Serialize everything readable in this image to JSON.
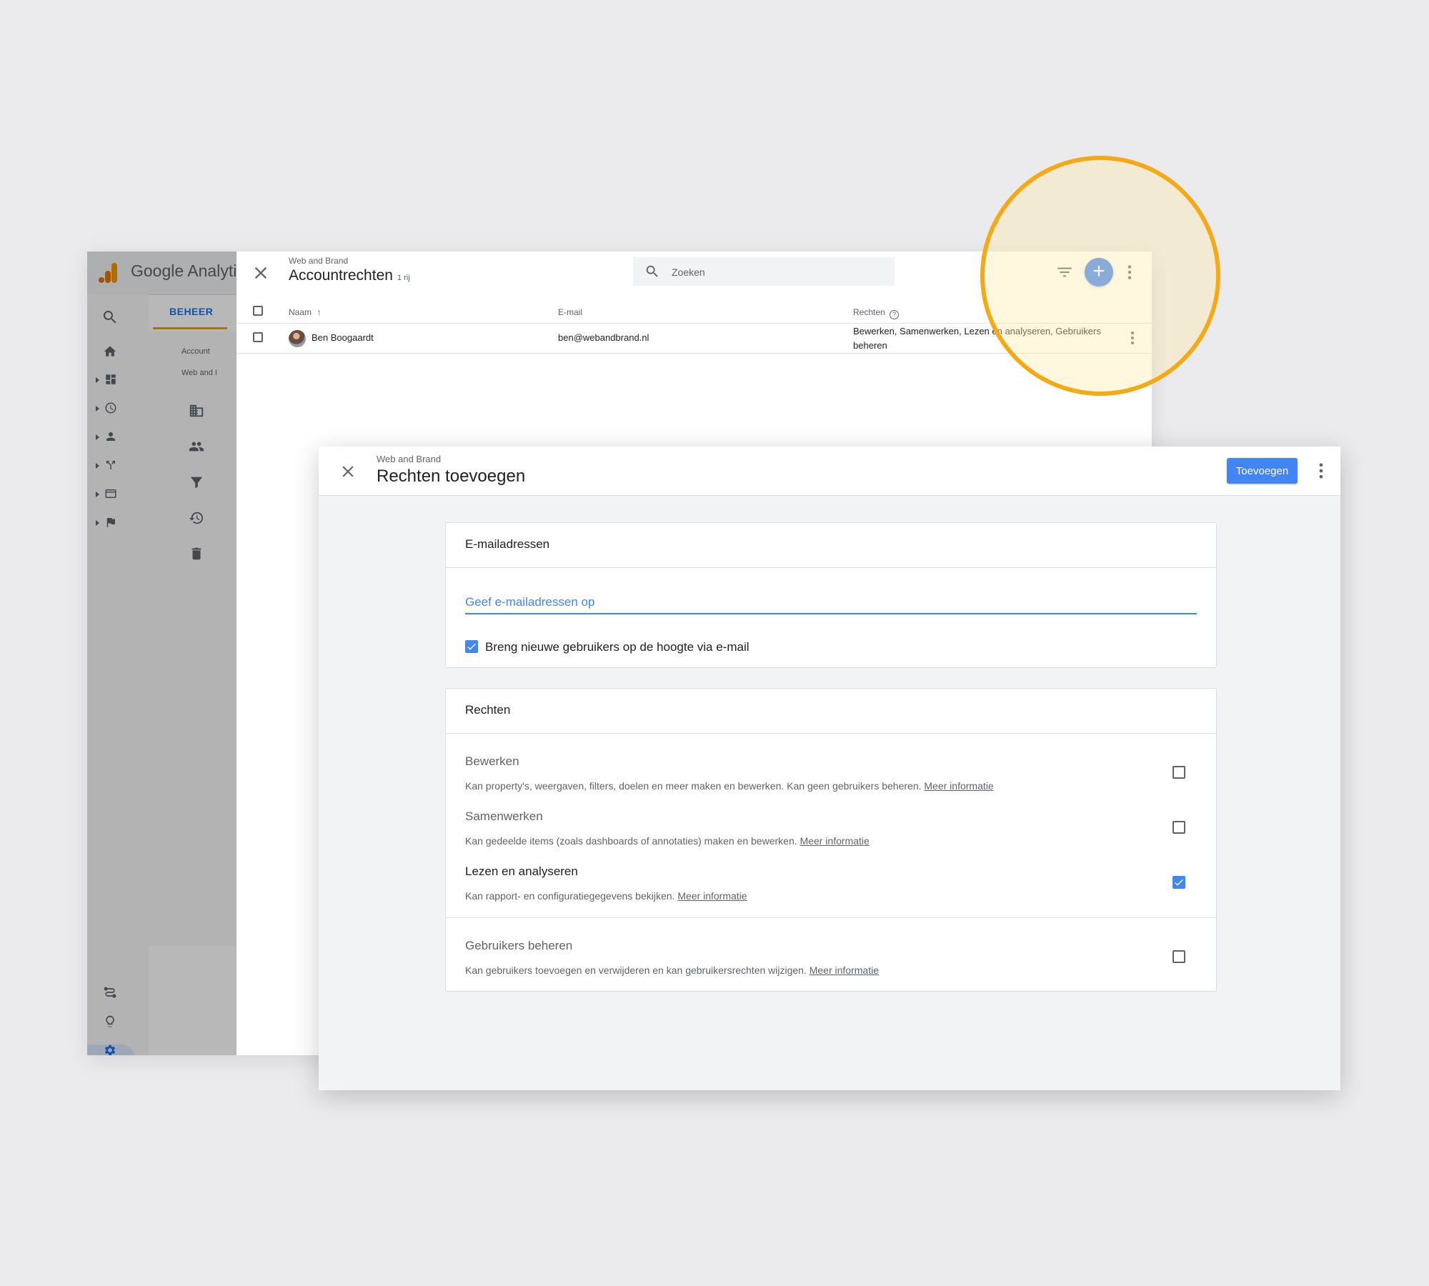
{
  "analytics": {
    "app_title": "Google Analytic",
    "tab_label": "BEHEER",
    "account_label": "Account",
    "account_value": "Web and I",
    "brand_colors": {
      "logo_orange": "#f29900",
      "logo_dark": "#e37400",
      "accent_blue": "#1a73e8"
    }
  },
  "account_rights": {
    "subtitle": "Web and Brand",
    "title": "Accountrechten",
    "row_count": "1 rij",
    "search_placeholder": "Zoeken",
    "columns": {
      "name": "Naam",
      "email": "E-mail",
      "rights": "Rechten"
    },
    "rows": [
      {
        "name": "Ben Boogaardt",
        "email": "ben@webandbrand.nl",
        "rights": "Bewerken, Samenwerken, Lezen en analyseren, Gebruikers beheren"
      }
    ]
  },
  "add_dialog": {
    "subtitle": "Web and Brand",
    "title": "Rechten toevoegen",
    "add_button": "Toevoegen",
    "email_section": {
      "title": "E-mailadressen",
      "input_placeholder": "Geef e-mailadressen op",
      "input_value": "",
      "notify_label": "Breng nieuwe gebruikers op de hoogte via e-mail",
      "notify_checked": true
    },
    "rights_section": {
      "title": "Rechten",
      "permissions": [
        {
          "title": "Bewerken",
          "description": "Kan property's, weergaven, filters, doelen en meer maken en bewerken. Kan geen gebruikers beheren.",
          "link": "Meer informatie",
          "checked": false
        },
        {
          "title": "Samenwerken",
          "description": "Kan gedeelde items (zoals dashboards of annotaties) maken en bewerken.",
          "link": "Meer informatie",
          "checked": false
        },
        {
          "title": "Lezen en analyseren",
          "description": "Kan rapport- en configuratiegegevens bekijken.",
          "link": "Meer informatie",
          "checked": true
        },
        {
          "title": "Gebruikers beheren",
          "description": "Kan gebruikers toevoegen en verwijderen en kan gebruikersrechten wijzigen.",
          "link": "Meer informatie",
          "checked": false
        }
      ]
    }
  },
  "highlight_color": "#f4a916"
}
